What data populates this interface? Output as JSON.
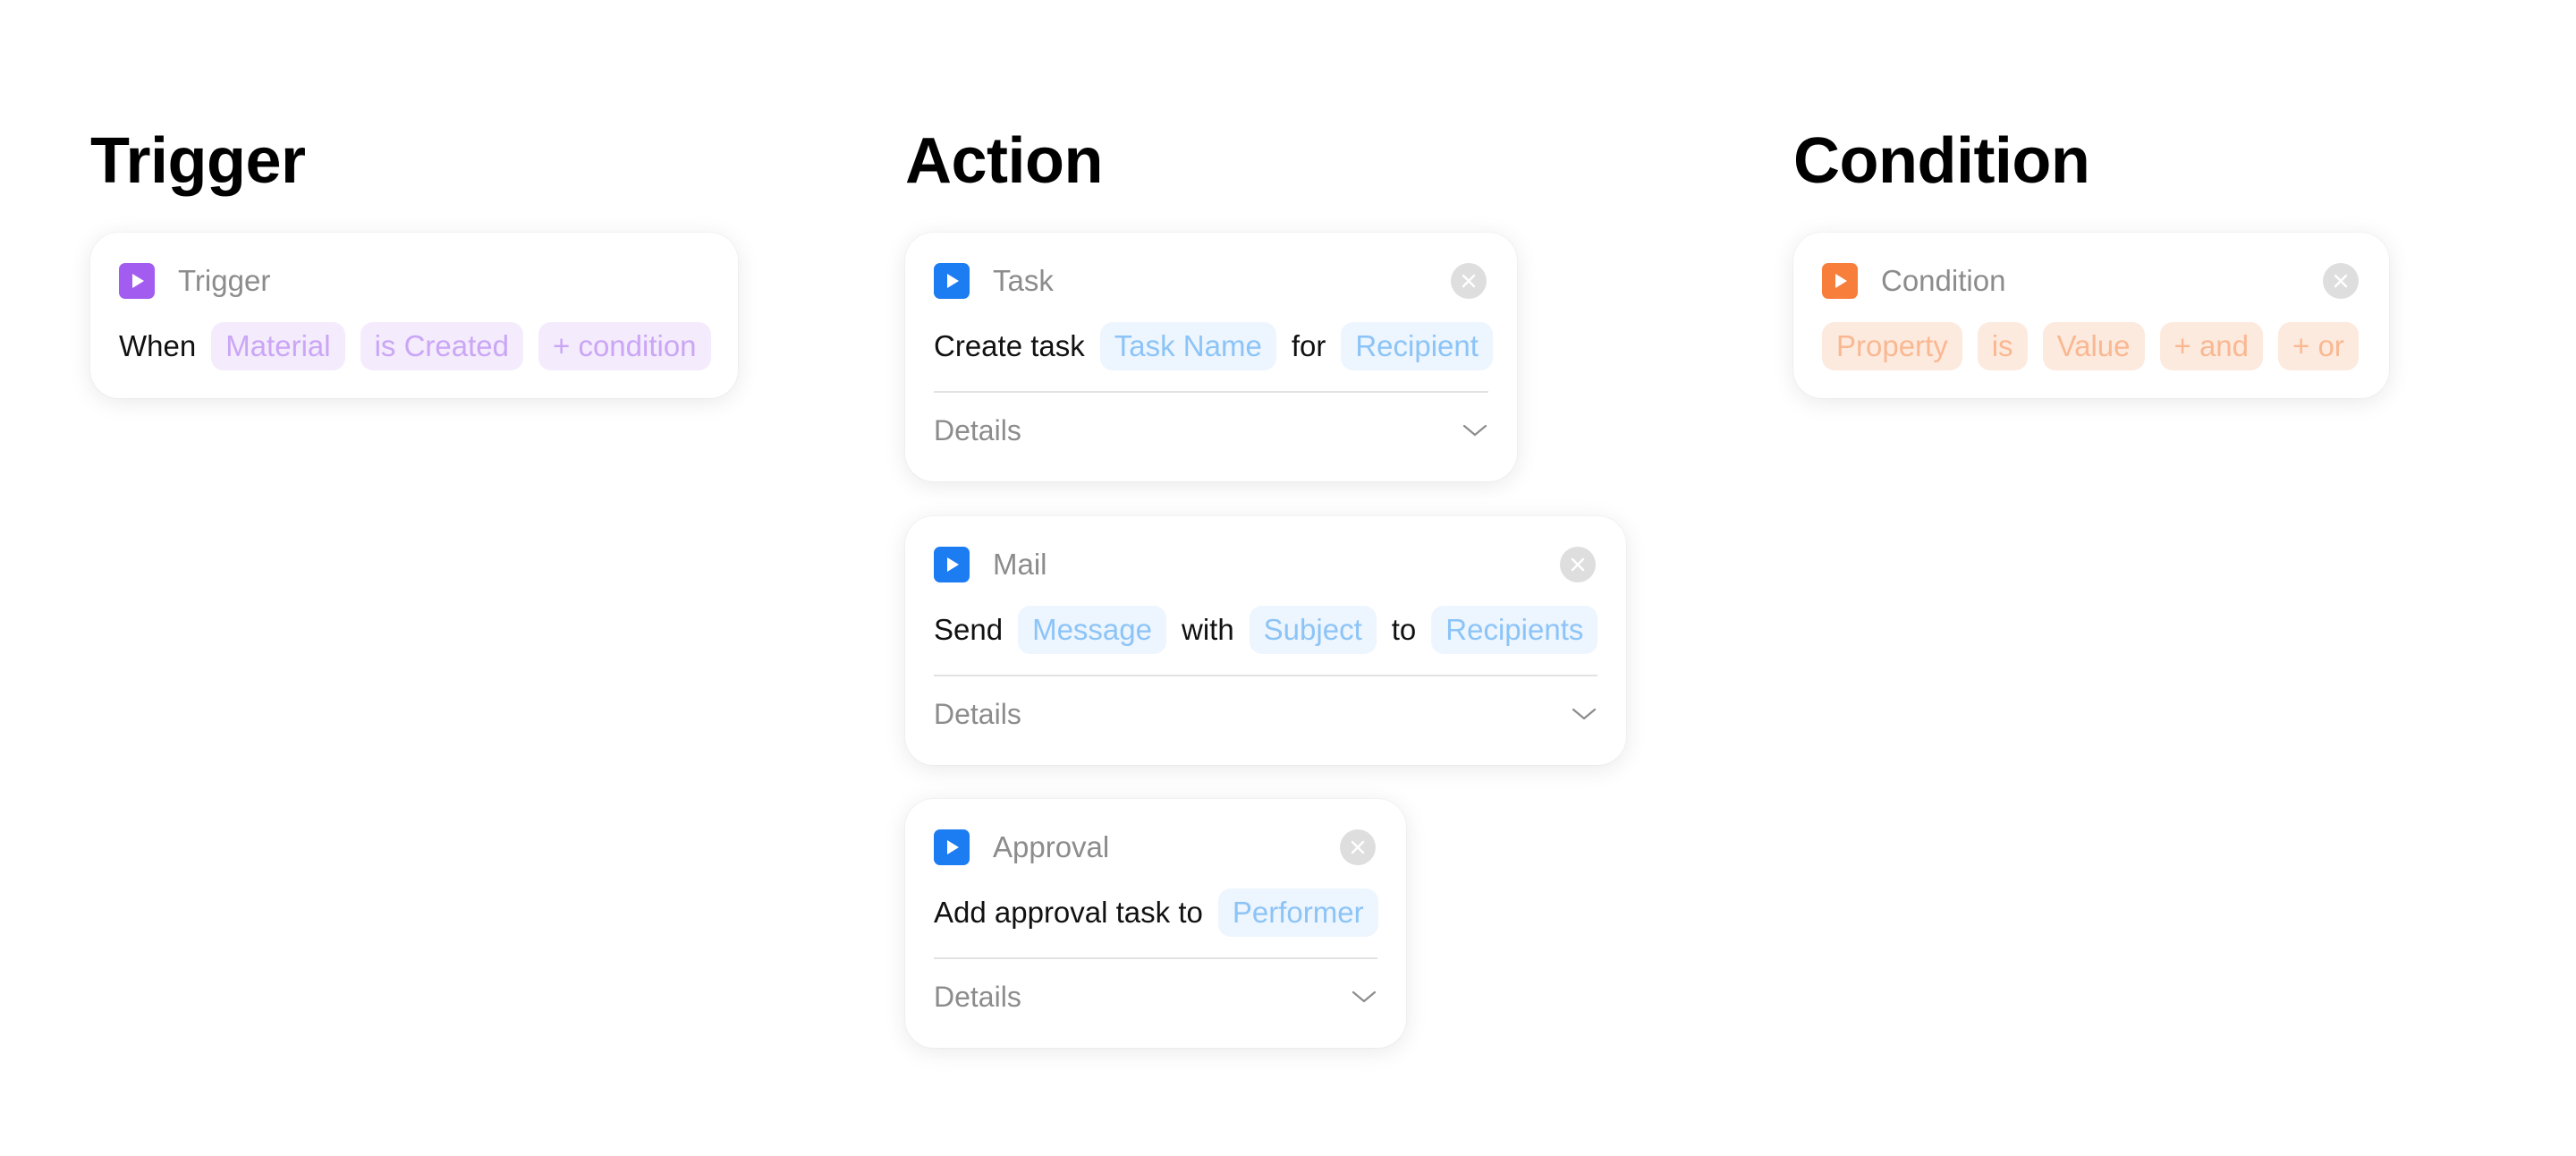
{
  "columns": {
    "trigger": {
      "title": "Trigger"
    },
    "action": {
      "title": "Action"
    },
    "condition": {
      "title": "Condition"
    }
  },
  "trigger_card": {
    "label": "Trigger",
    "icon": "play-icon",
    "color": "#a35cf0",
    "sentence": {
      "when": "When",
      "material": "Material",
      "is_created": "is Created",
      "add_condition": "+ condition"
    }
  },
  "task_card": {
    "label": "Task",
    "icon": "play-icon",
    "color": "#1c7cf2",
    "sentence": {
      "create_task": "Create task",
      "task_name": "Task Name",
      "for": "for",
      "recipient": "Recipient"
    },
    "details": "Details"
  },
  "mail_card": {
    "label": "Mail",
    "icon": "play-icon",
    "color": "#1c7cf2",
    "sentence": {
      "send": "Send",
      "message": "Message",
      "with": "with",
      "subject": "Subject",
      "to": "to",
      "recipients": "Recipients"
    },
    "details": "Details"
  },
  "approval_card": {
    "label": "Approval",
    "icon": "play-icon",
    "color": "#1c7cf2",
    "sentence": {
      "add_approval": "Add approval task to",
      "performer": "Performer"
    },
    "details": "Details"
  },
  "condition_card": {
    "label": "Condition",
    "icon": "play-icon",
    "color": "#f87e3b",
    "sentence": {
      "property": "Property",
      "is": "is",
      "value": "Value",
      "add_and": "+ and",
      "add_or": "+ or"
    }
  }
}
